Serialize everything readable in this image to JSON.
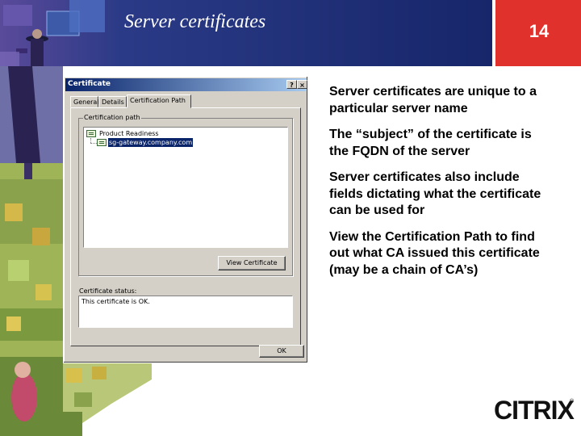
{
  "header": {
    "slide_title": "Server certificates",
    "slide_number": "14"
  },
  "dialog": {
    "title": "Certificate",
    "help_button": "?",
    "close_button": "×",
    "tabs": [
      {
        "label": "General",
        "active": false
      },
      {
        "label": "Details",
        "active": false
      },
      {
        "label": "Certification Path",
        "active": true
      }
    ],
    "certification_path_label": "Certification path",
    "tree": [
      {
        "label": "Product Readiness",
        "level": 0,
        "selected": false
      },
      {
        "label": "sg-gateway.company.com",
        "level": 1,
        "selected": true
      }
    ],
    "view_certificate_button": "View Certificate",
    "certificate_status_label": "Certificate status:",
    "certificate_status_text": "This certificate is OK.",
    "ok_button": "OK"
  },
  "bullets": [
    "Server certificates are unique to a particular server name",
    "The “subject” of the certificate is the FQDN of the server",
    "Server certificates also include fields dictating what the certificate can be used for",
    "View the Certification Path to find out what CA issued this certificate (may be a chain of CA’s)"
  ],
  "logo": {
    "text": "CITRIX",
    "registered": "®"
  },
  "colors": {
    "header_blue": "#1a2a6e",
    "number_red": "#e0312d",
    "dialog_gray": "#d4d0c8",
    "titlebar_blue": "#0a246a"
  }
}
